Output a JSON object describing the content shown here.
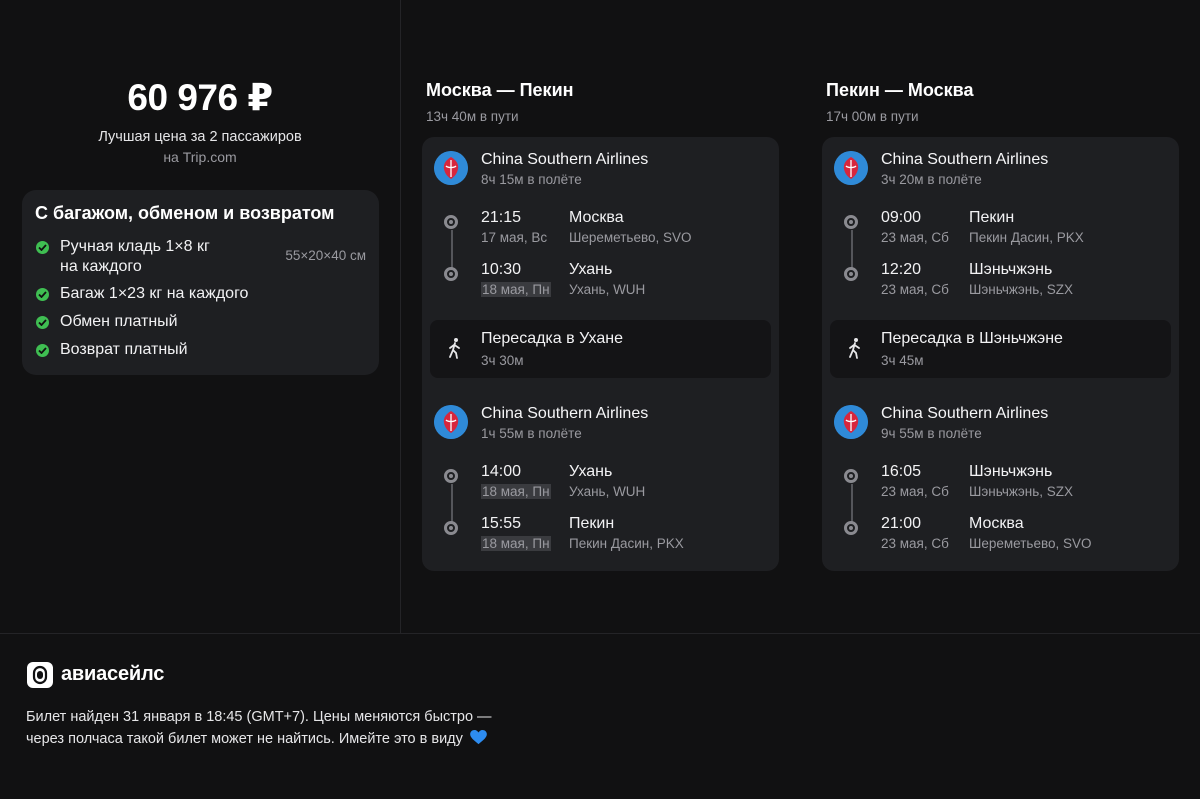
{
  "offer": {
    "price": "60 976 ₽",
    "price_caption": "Лучшая цена за 2 пассажиров",
    "source": "на Trip.com"
  },
  "tariff": {
    "title": "С багажом, обменом и возвратом",
    "features": [
      {
        "label_line1": "Ручная кладь 1×8 кг",
        "label_line2": "на каждого",
        "note": "55×20×40 см"
      },
      {
        "label": "Багаж 1×23 кг на каждого"
      },
      {
        "label": "Обмен платный"
      },
      {
        "label": "Возврат платный"
      }
    ],
    "check_color": "#3fbe52"
  },
  "routes": [
    {
      "title": "Москва — Пекин",
      "duration": "13ч 40м в пути",
      "segments": [
        {
          "airline": "China Southern Airlines",
          "flight_time": "8ч 15м в полёте",
          "departure": {
            "time": "21:15",
            "date": "17 мая, Вс",
            "city": "Москва",
            "airport": "Шереметьево, SVO"
          },
          "arrival": {
            "time": "10:30",
            "date": "18 мая, Пн",
            "city": "Ухань",
            "airport": "Ухань, WUH"
          }
        },
        {
          "airline": "China Southern Airlines",
          "flight_time": "1ч 55м в полёте",
          "departure": {
            "time": "14:00",
            "date": "18 мая, Пн",
            "city": "Ухань",
            "airport": "Ухань, WUH"
          },
          "arrival": {
            "time": "15:55",
            "date": "18 мая, Пн",
            "city": "Пекин",
            "airport": "Пекин Дасин, PKX"
          }
        }
      ],
      "transfer": {
        "title": "Пересадка в Ухане",
        "duration": "3ч 30м",
        "icon": "walking-person-icon"
      }
    },
    {
      "title": "Пекин — Москва",
      "duration": "17ч 00м в пути",
      "segments": [
        {
          "airline": "China Southern Airlines",
          "flight_time": "3ч 20м в полёте",
          "departure": {
            "time": "09:00",
            "date": "23 мая, Сб",
            "city": "Пекин",
            "airport": "Пекин Дасин, PKX"
          },
          "arrival": {
            "time": "12:20",
            "date": "23 мая, Сб",
            "city": "Шэньчжэнь",
            "airport": "Шэньчжэнь, SZX"
          }
        },
        {
          "airline": "China Southern Airlines",
          "flight_time": "9ч 55м в полёте",
          "departure": {
            "time": "16:05",
            "date": "23 мая, Сб",
            "city": "Шэньчжэнь",
            "airport": "Шэньчжэнь, SZX"
          },
          "arrival": {
            "time": "21:00",
            "date": "23 мая, Сб",
            "city": "Москва",
            "airport": "Шереметьево, SVO"
          }
        }
      ],
      "transfer": {
        "title": "Пересадка в Шэньчжэне",
        "duration": "3ч 45м",
        "icon": "walking-person-icon"
      }
    }
  ],
  "footer": {
    "brand": "авиасейлс",
    "note_line1": "Билет найден 31 января в 18:45 (GMT+7). Цены меняются быстро —",
    "note_line2": "через полчаса такой билет может не найтись. Имейте это в виду",
    "emoji": "blue-heart-icon"
  },
  "colors": {
    "background": "#111112",
    "card": "#1e1f22",
    "muted_text": "#9a9aa0",
    "airline_logo_blue": "#2f8ad8",
    "airline_logo_red": "#d7263d",
    "heart": "#2d8cf0"
  }
}
